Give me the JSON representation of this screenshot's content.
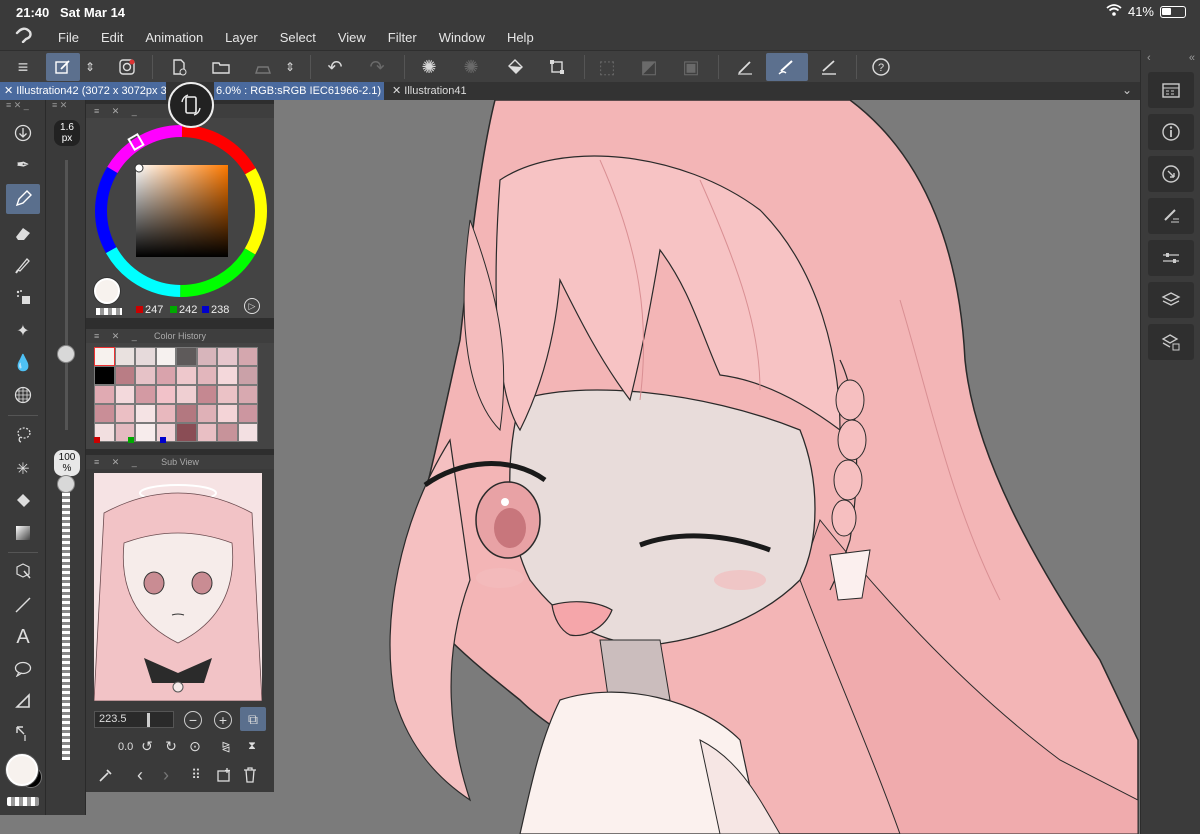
{
  "status": {
    "time": "21:40",
    "date": "Sat Mar 14",
    "battery": "41%"
  },
  "menu": [
    "File",
    "Edit",
    "Animation",
    "Layer",
    "Select",
    "View",
    "Filter",
    "Window",
    "Help"
  ],
  "toolbar": {
    "icons": [
      "hamburger-menu-icon",
      "edit-mode-icon",
      "up-down-icon",
      "spiral-icon",
      "new-canvas-icon",
      "open-folder-icon",
      "save-icon",
      "up-down-icon",
      "undo-icon",
      "redo-icon",
      "loading-icon",
      "loading-dim-icon",
      "fill-bucket-icon",
      "transform-icon",
      "deselect-icon",
      "invert-select-icon",
      "select-border-icon",
      "pen-settings-icon",
      "brush-icon",
      "ruler-pen-icon",
      "help-icon"
    ]
  },
  "tabs": {
    "active": "Illustration42 (3072 x 3072px 3",
    "active_suffix": "6.0% : RGB:sRGB IEC61966-2.1)",
    "other": "Illustration41"
  },
  "tool_size": {
    "value": "1.6",
    "unit": "px",
    "level": 0.28
  },
  "tool_opacity": {
    "value": "100",
    "unit": "%",
    "level": 1.0
  },
  "color_panel": {
    "title": "Co",
    "r": "247",
    "g": "242",
    "b": "238",
    "current_color": "#f7f2ee"
  },
  "color_history": {
    "title": "Color History",
    "swatches": [
      "#f7f2ee",
      "#e9e1df",
      "#e6dadb",
      "#f6f1ef",
      "#5e5a5a",
      "#d7b5bb",
      "#e6c6cc",
      "#d4a7ae",
      "#000000",
      "#b97d85",
      "#e6c2c7",
      "#d9a3ac",
      "#eec8cc",
      "#e2b6bc",
      "#f4d8db",
      "#caa1a8",
      "#e0aab2",
      "#f3d9dc",
      "#d39aa3",
      "#f2c2c9",
      "#efcfd2",
      "#c58891",
      "#ebc2c6",
      "#d8a9b0",
      "#c98e97",
      "#ebbfc4",
      "#f5e3e4",
      "#e8b8be",
      "#b37880",
      "#dfb1b7",
      "#f4d4d7",
      "#cc96a0",
      "#f2dfe0",
      "#e4bac0",
      "#f7ecec",
      "#f0d1d5",
      "#8a4d55",
      "#e9bfc4",
      "#c7939a",
      "#f3e0e2"
    ]
  },
  "sub_view": {
    "title": "Sub View",
    "zoom": "223.5",
    "angle": "0.0"
  },
  "right_panel": {
    "icons": [
      "calendar-icon",
      "info-icon",
      "search-navigator-icon",
      "tool-property-icon",
      "sliders-icon",
      "layers-icon",
      "layer-property-icon"
    ]
  },
  "colors": {
    "accent": "#5a6f8d",
    "tab_active": "#4a6a9e",
    "canvas_bg": "#7b7b7b",
    "hair": "#f4b7b8"
  }
}
